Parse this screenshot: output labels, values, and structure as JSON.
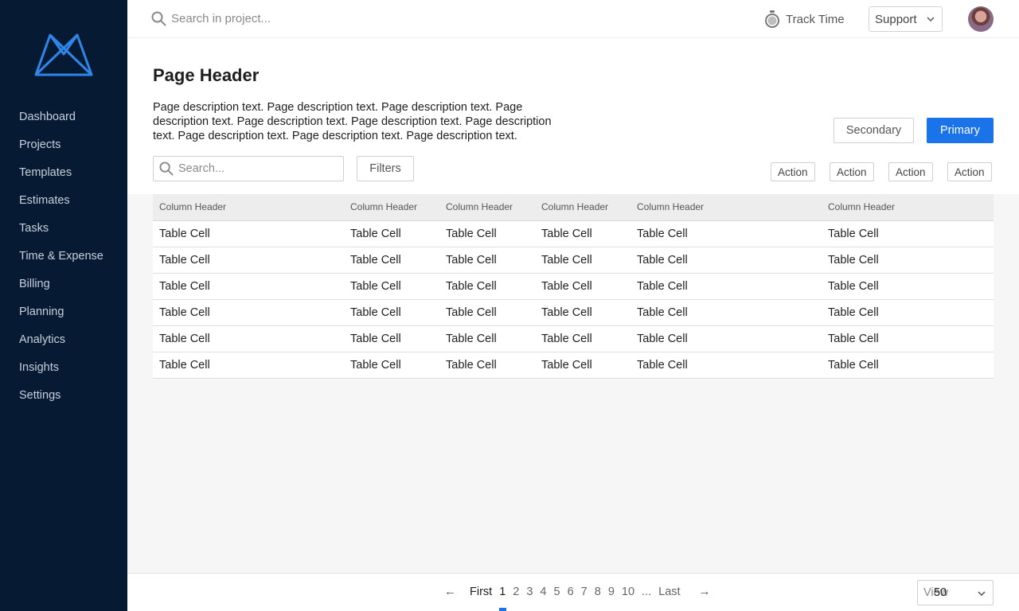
{
  "sidebar": {
    "logo": "m-logo-icon",
    "items": [
      {
        "label": "Dashboard"
      },
      {
        "label": "Projects"
      },
      {
        "label": "Templates"
      },
      {
        "label": "Estimates"
      },
      {
        "label": "Tasks"
      },
      {
        "label": "Time & Expense"
      },
      {
        "label": "Billing"
      },
      {
        "label": "Planning"
      },
      {
        "label": "Analytics"
      },
      {
        "label": "Insights"
      },
      {
        "label": "Settings"
      }
    ]
  },
  "topbar": {
    "search_placeholder": "Search in project...",
    "track_time_label": "Track Time",
    "support_label": "Support"
  },
  "header": {
    "title": "Page Header",
    "description": "Page description text. Page description text. Page description text. Page description text. Page description text. Page description text. Page description text. Page description text. Page description text. Page description text.",
    "secondary_label": "Secondary",
    "primary_label": "Primary",
    "search_placeholder": "Search...",
    "filters_label": "Filters",
    "actions": [
      "Action",
      "Action",
      "Action",
      "Action"
    ]
  },
  "table": {
    "columns": [
      "Column Header",
      "Column Header",
      "Column Header",
      "Column Header",
      "Column Header",
      "Column Header"
    ],
    "rows": [
      [
        "Table Cell",
        "Table Cell",
        "Table Cell",
        "Table Cell",
        "Table Cell",
        "Table Cell"
      ],
      [
        "Table Cell",
        "Table Cell",
        "Table Cell",
        "Table Cell",
        "Table Cell",
        "Table Cell"
      ],
      [
        "Table Cell",
        "Table Cell",
        "Table Cell",
        "Table Cell",
        "Table Cell",
        "Table Cell"
      ],
      [
        "Table Cell",
        "Table Cell",
        "Table Cell",
        "Table Cell",
        "Table Cell",
        "Table Cell"
      ],
      [
        "Table Cell",
        "Table Cell",
        "Table Cell",
        "Table Cell",
        "Table Cell",
        "Table Cell"
      ],
      [
        "Table Cell",
        "Table Cell",
        "Table Cell",
        "Table Cell",
        "Table Cell",
        "Table Cell"
      ]
    ]
  },
  "pagination": {
    "prev": "←",
    "first": "First",
    "pages": [
      "1",
      "2",
      "3",
      "4",
      "5",
      "6",
      "7",
      "8",
      "9",
      "10"
    ],
    "current": "1",
    "ellipsis": "...",
    "last": "Last",
    "next": "→",
    "view_label": "View",
    "view_value": "50"
  },
  "colors": {
    "sidebar_bg": "#061a33",
    "accent": "#1a73e8",
    "logo": "#2f86e8"
  }
}
